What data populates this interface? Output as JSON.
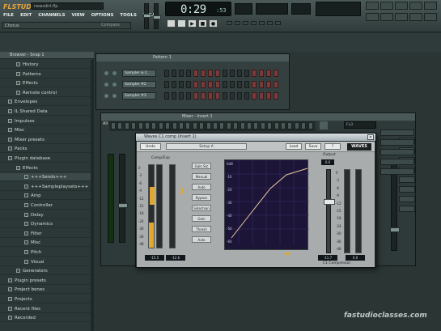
{
  "app": {
    "logo": "FLSTUDIO",
    "song_title": "newsdirt.flp"
  },
  "menu": [
    "FILE",
    "EDIT",
    "CHANNELS",
    "VIEW",
    "OPTIONS",
    "TOOLS",
    "HELP"
  ],
  "hint_bar": {
    "text": "Chorus",
    "right": "Compass"
  },
  "transport": {
    "time": "0:29",
    "time_ms": ":53"
  },
  "browser": {
    "title": "Browser - Snap 1",
    "items": [
      {
        "label": "History",
        "indent": 1,
        "selected": false
      },
      {
        "label": "Patterns",
        "indent": 1,
        "selected": false
      },
      {
        "label": "Effects",
        "indent": 1,
        "selected": false
      },
      {
        "label": "Remote control",
        "indent": 1,
        "selected": false
      },
      {
        "label": "Envelopes",
        "indent": 0,
        "selected": false
      },
      {
        "label": "IL Shared Data",
        "indent": 0,
        "selected": false
      },
      {
        "label": "Impulses",
        "indent": 0,
        "selected": false
      },
      {
        "label": "Misc",
        "indent": 0,
        "selected": false
      },
      {
        "label": "Mixer presets",
        "indent": 0,
        "selected": false
      },
      {
        "label": "Packs",
        "indent": 0,
        "selected": false
      },
      {
        "label": "Plugin database",
        "indent": 0,
        "selected": false
      },
      {
        "label": "Effects",
        "indent": 1,
        "selected": false
      },
      {
        "label": "+++Sends+++",
        "indent": 2,
        "selected": true
      },
      {
        "label": "+++Sampleplaysets+++",
        "indent": 2,
        "selected": false
      },
      {
        "label": "Amp",
        "indent": 2,
        "selected": false
      },
      {
        "label": "Controller",
        "indent": 2,
        "selected": false
      },
      {
        "label": "Delay",
        "indent": 2,
        "selected": false
      },
      {
        "label": "Dynamics",
        "indent": 2,
        "selected": false
      },
      {
        "label": "Filter",
        "indent": 2,
        "selected": false
      },
      {
        "label": "Misc",
        "indent": 2,
        "selected": false
      },
      {
        "label": "Pitch",
        "indent": 2,
        "selected": false
      },
      {
        "label": "Visual",
        "indent": 2,
        "selected": false
      },
      {
        "label": "Generators",
        "indent": 1,
        "selected": false
      },
      {
        "label": "Plugin presets",
        "indent": 0,
        "selected": false
      },
      {
        "label": "Project bones",
        "indent": 0,
        "selected": false
      },
      {
        "label": "Projects",
        "indent": 0,
        "selected": false
      },
      {
        "label": "Recent files",
        "indent": 0,
        "selected": false
      },
      {
        "label": "Recorded",
        "indent": 0,
        "selected": false
      }
    ]
  },
  "step_sequencer": {
    "title": "Pattern 1",
    "channels": [
      {
        "name": "Sampler & C."
      },
      {
        "name": "Sampler #2"
      },
      {
        "name": "Sampler #3"
      }
    ]
  },
  "mixer": {
    "title": "Mixer - Insert 1",
    "label_all": "All",
    "send_field": "Fx3"
  },
  "plugin": {
    "title": "Waves C1 comp (Insert 1)",
    "preset_buttons": [
      "Undo",
      "Setup A",
      "Load",
      "Save",
      "?"
    ],
    "preset_name": "Setup A",
    "logo": "WAVES",
    "left_section": "Comp/Exp",
    "attack_label": "Attack",
    "attack_value": "10",
    "release_label": "Release",
    "release_value": "150",
    "ratio_label": "Ratio",
    "ratio_value": "2",
    "knee_label": "Knee",
    "makeup_label": "Makeup",
    "gain_label": "Gain",
    "output_label": "Output",
    "output_value": "0.0",
    "left_vals": [
      "-15.5",
      "-12.6"
    ],
    "right_vals": [
      "-11.7",
      "0.0"
    ],
    "footer": "C1 Compressor",
    "graph_y_ticks": [
      "0dB",
      "-10",
      "-20",
      "-30",
      "-40",
      "-50",
      "-60"
    ],
    "graph_x_ticks": [
      "-60",
      "-50",
      "-40",
      "-30",
      "-20",
      "-10",
      "0dB"
    ],
    "side_buttons": [
      "Gain Src",
      "Manual",
      "Auto",
      "Bypass",
      "Sidechain",
      "Gain",
      "Thresh",
      "Auto"
    ]
  },
  "watermark": "fastudioclasses.com"
}
